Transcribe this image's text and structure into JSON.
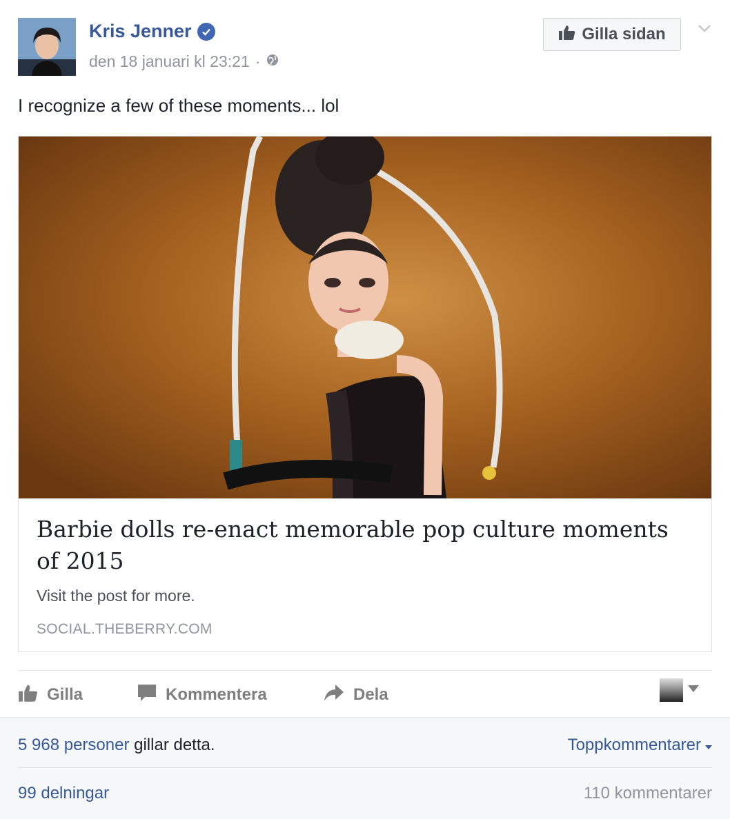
{
  "post": {
    "author": "Kris Jenner",
    "timestamp": "den 18 januari kl 23:21",
    "separator": "·",
    "audience_icon": "globe-icon",
    "verified_icon": "verified-badge-icon",
    "like_page_label": "Gilla sidan",
    "text": "I recognize a few of these moments... lol"
  },
  "link_card": {
    "title": "Barbie dolls re-enact memorable pop culture moments of 2015",
    "description": "Visit the post for more.",
    "domain": "SOCIAL.THEBERRY.COM"
  },
  "actions": {
    "like": "Gilla",
    "comment": "Kommentera",
    "share": "Dela"
  },
  "stats": {
    "likes_count": "5 968 personer",
    "likes_suffix": " gillar detta.",
    "top_comments": "Toppkommentarer",
    "shares": "99 delningar",
    "comments": "110 kommentarer"
  },
  "colors": {
    "link_blue": "#365899",
    "muted_gray": "#90949c",
    "verified_blue": "#4267b2"
  }
}
